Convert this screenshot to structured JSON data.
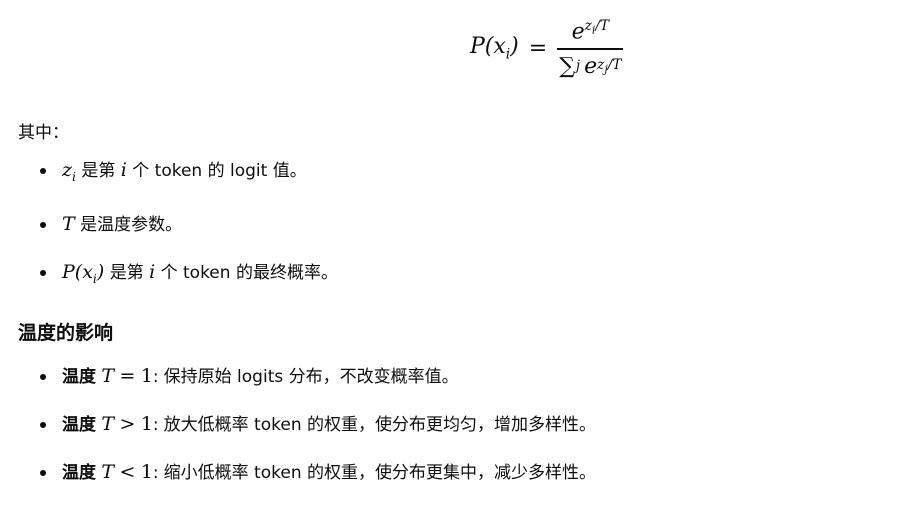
{
  "formula": {
    "lhs": "P(x",
    "lhs_sub": "i",
    "lhs_close": ")",
    "eq": "=",
    "num_base": "e",
    "num_exp_z": "z",
    "num_exp_sub": "i",
    "num_exp_rest": "/T",
    "den_sigma": "∑",
    "den_sigma_sub": "j",
    "den_base": "e",
    "den_exp_z": "z",
    "den_exp_sub": "j",
    "den_exp_rest": "/T"
  },
  "intro": "其中：",
  "definitions": [
    {
      "var": "z",
      "sub": "i",
      "text_before": "是第",
      "mid_var": "i",
      "text_after": "个 token 的 logit 值。"
    },
    {
      "var": "T",
      "text": "是温度参数。"
    },
    {
      "var": "P(x",
      "sub": "i",
      "close": ")",
      "text_before": "是第",
      "mid_var": "i",
      "text_after": "个 token 的最终概率。"
    }
  ],
  "section_title": "温度的影响",
  "effects": [
    {
      "label": "温度",
      "var": "T",
      "op": "=",
      "num": "1",
      "colon": ":",
      "text": "保持原始 logits 分布，不改变概率值。"
    },
    {
      "label": "温度",
      "var": "T",
      "op": ">",
      "num": "1",
      "colon": ":",
      "text": "放大低概率 token 的权重，使分布更均匀，增加多样性。"
    },
    {
      "label": "温度",
      "var": "T",
      "op": "<",
      "num": "1",
      "colon": ":",
      "text": "缩小低概率 token 的权重，使分布更集中，减少多样性。"
    }
  ]
}
